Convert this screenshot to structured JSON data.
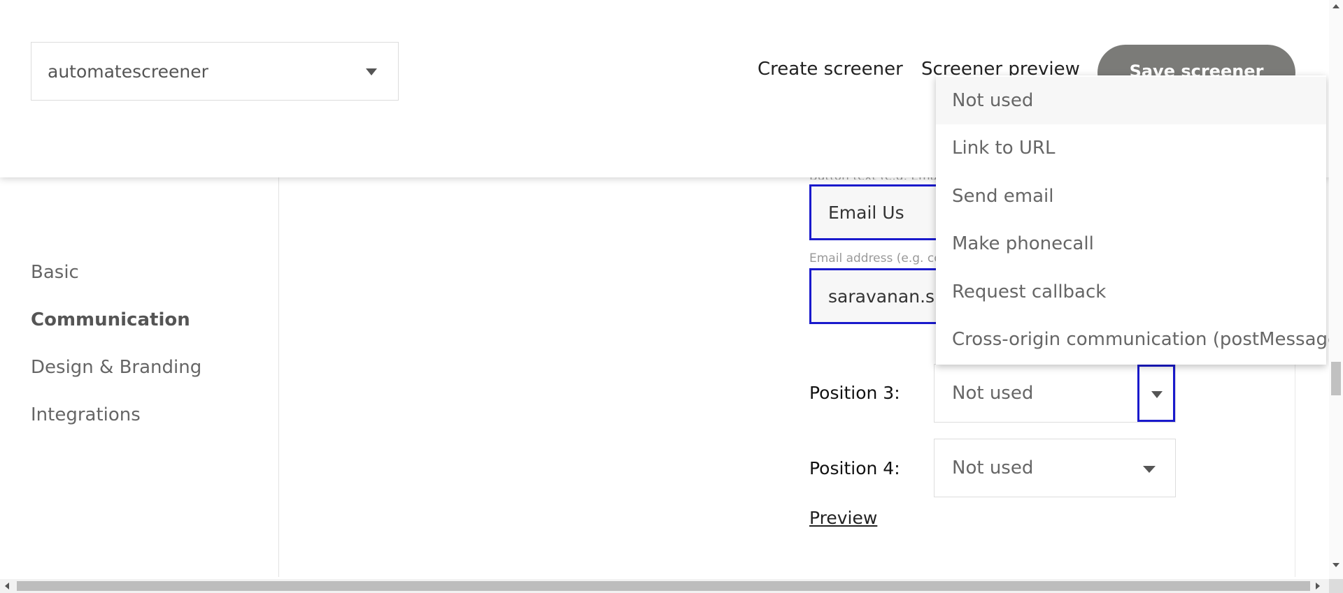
{
  "header": {
    "screener_select_value": "automatescreener",
    "create_link": "Create screener",
    "preview_link": "Screener preview",
    "save_label": "Save screener"
  },
  "sidebar": {
    "items": [
      {
        "label": "Basic",
        "active": false
      },
      {
        "label": "Communication",
        "active": true
      },
      {
        "label": "Design & Branding",
        "active": false
      },
      {
        "label": "Integrations",
        "active": false
      }
    ]
  },
  "main": {
    "button_text_label": "Button text (e.g. Email",
    "button_text_value": "Email Us",
    "email_label": "Email address (e.g. co",
    "email_value": "saravanan.sh",
    "position3_label": "Position 3:",
    "position3_value": "Not used",
    "position4_label": "Position 4:",
    "position4_value": "Not used",
    "preview_label": "Preview"
  },
  "dropdown": {
    "options": [
      "Not used",
      "Link to URL",
      "Send email",
      "Make phonecall",
      "Request callback",
      "Cross-origin communication (postMessage)"
    ],
    "highlighted_index": 0
  },
  "colors": {
    "focus_border": "#1a1acc",
    "save_button": "#7b7b78"
  }
}
